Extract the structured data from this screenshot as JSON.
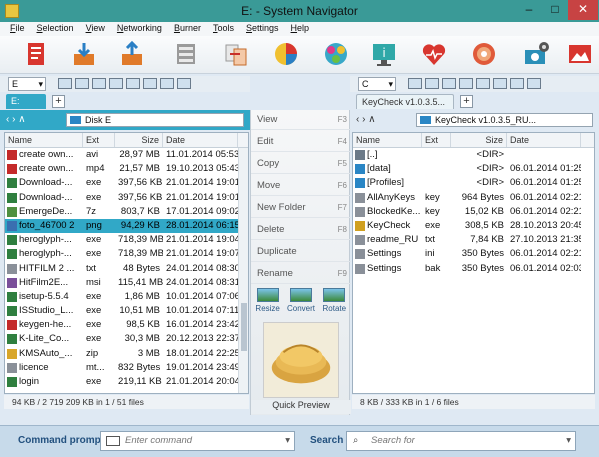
{
  "window": {
    "title": "E: - System Navigator",
    "min": "–",
    "max": "□",
    "close": "✕"
  },
  "menu": [
    "File",
    "Selection",
    "View",
    "Networking",
    "Burner",
    "Tools",
    "Settings",
    "Help"
  ],
  "toolbar_icons": [
    "red-document-icon",
    "download-box-icon",
    "upload-box-icon",
    "archive-icon",
    "compare-icon",
    "pie-chart-icon",
    "network-icon",
    "info-monitor-icon",
    "heart-pulse-icon",
    "disc-icon",
    "camera-gear-icon"
  ],
  "left": {
    "drive": "E",
    "tab": "E:",
    "path": "Disk E",
    "columns": [
      "Name",
      "Ext",
      "Size",
      "Date"
    ],
    "rows": [
      {
        "name": "create own...",
        "ext": "avi",
        "size": "28,97 MB",
        "date": "11.01.2014 05:53",
        "icon": "video-file-icon",
        "color": "#c42a2a"
      },
      {
        "name": "create own...",
        "ext": "mp4",
        "size": "21,57 MB",
        "date": "19.10.2013 05:43",
        "icon": "video-file-icon",
        "color": "#c42a2a"
      },
      {
        "name": "Download-...",
        "ext": "exe",
        "size": "397,56 KB",
        "date": "21.01.2014 19:01",
        "icon": "exe-file-icon",
        "color": "#2f7f3f"
      },
      {
        "name": "Download-...",
        "ext": "exe",
        "size": "397,56 KB",
        "date": "21.01.2014 19:01",
        "icon": "exe-file-icon",
        "color": "#2f7f3f"
      },
      {
        "name": "EmergeDe...",
        "ext": "7z",
        "size": "803,7 KB",
        "date": "17.01.2014 09:02",
        "icon": "archive-file-icon",
        "color": "#4f8f3f"
      },
      {
        "name": "foto_46700 2",
        "ext": "png",
        "size": "94,29 KB",
        "date": "28.01.2014 06:15",
        "icon": "image-file-icon",
        "color": "#3a6fb0",
        "selected": true
      },
      {
        "name": "heroglyph-...",
        "ext": "exe",
        "size": "718,39 MB",
        "date": "21.01.2014 19:04",
        "icon": "exe-file-icon",
        "color": "#2f7f3f"
      },
      {
        "name": "heroglyph-...",
        "ext": "exe",
        "size": "718,39 MB",
        "date": "21.01.2014 19:07",
        "icon": "exe-file-icon",
        "color": "#2f7f3f"
      },
      {
        "name": "HITFILM 2 ...",
        "ext": "txt",
        "size": "48 Bytes",
        "date": "24.01.2014 08:30",
        "icon": "text-file-icon",
        "color": "#8a9099"
      },
      {
        "name": "HitFilm2E...",
        "ext": "msi",
        "size": "115,41 MB",
        "date": "24.01.2014 08:31",
        "icon": "installer-file-icon",
        "color": "#7a4f9a"
      },
      {
        "name": "isetup-5.5.4",
        "ext": "exe",
        "size": "1,86 MB",
        "date": "10.01.2014 07:06",
        "icon": "exe-file-icon",
        "color": "#2f7f3f"
      },
      {
        "name": "ISStudio_L...",
        "ext": "exe",
        "size": "10,51 MB",
        "date": "10.01.2014 07:11",
        "icon": "exe-file-icon",
        "color": "#2f7f3f"
      },
      {
        "name": "keygen-he...",
        "ext": "exe",
        "size": "98,5 KB",
        "date": "16.01.2014 23:42",
        "icon": "exe-file-icon",
        "color": "#c42a2a"
      },
      {
        "name": "K-Lite_Co...",
        "ext": "exe",
        "size": "30,3 MB",
        "date": "20.12.2013 22:37",
        "icon": "exe-file-icon",
        "color": "#2f7f3f"
      },
      {
        "name": "KMSAuto_...",
        "ext": "zip",
        "size": "3 MB",
        "date": "18.01.2014 22:25",
        "icon": "zip-file-icon",
        "color": "#d8a62a"
      },
      {
        "name": "licence",
        "ext": "mt...",
        "size": "832 Bytes",
        "date": "19.01.2014 23:49",
        "icon": "text-file-icon",
        "color": "#8a9099"
      },
      {
        "name": "login",
        "ext": "exe",
        "size": "219,11 KB",
        "date": "21.01.2014 20:04",
        "icon": "exe-file-icon",
        "color": "#2f7f3f"
      }
    ],
    "status": "94 KB / 2 719 209 KB  in 1 / 51 files"
  },
  "right": {
    "drive": "C",
    "tab": "KeyCheck v1.0.3.5...",
    "path": "KeyCheck v1.0.3.5_RU...",
    "columns": [
      "Name",
      "Ext",
      "Size",
      "Date"
    ],
    "rows": [
      {
        "name": "[..]",
        "ext": "",
        "size": "<DIR>",
        "date": "",
        "icon": "up-folder-icon",
        "color": "#6c7a88"
      },
      {
        "name": "[data]",
        "ext": "",
        "size": "<DIR>",
        "date": "06.01.2014 01:25",
        "icon": "folder-icon",
        "color": "#2a86c5"
      },
      {
        "name": "[Profiles]",
        "ext": "",
        "size": "<DIR>",
        "date": "06.01.2014 01:25",
        "icon": "folder-icon",
        "color": "#2a86c5"
      },
      {
        "name": "AllAnyKeys",
        "ext": "key",
        "size": "964 Bytes",
        "date": "06.01.2014 02:21",
        "icon": "key-file-icon",
        "color": "#8a9099"
      },
      {
        "name": "BlockedKe...",
        "ext": "key",
        "size": "15,02 KB",
        "date": "06.01.2014 02:21",
        "icon": "key-file-icon",
        "color": "#8a9099"
      },
      {
        "name": "KeyCheck",
        "ext": "exe",
        "size": "308,5 KB",
        "date": "28.10.2013 20:45",
        "icon": "keycheck-app-icon",
        "color": "#d0a020"
      },
      {
        "name": "readme_RU",
        "ext": "txt",
        "size": "7,84 KB",
        "date": "27.10.2013 21:35",
        "icon": "text-file-icon",
        "color": "#8a9099"
      },
      {
        "name": "Settings",
        "ext": "ini",
        "size": "350 Bytes",
        "date": "06.01.2014 02:21",
        "icon": "settings-file-icon",
        "color": "#8a9099"
      },
      {
        "name": "Settings",
        "ext": "bak",
        "size": "350 Bytes",
        "date": "06.01.2014 02:03",
        "icon": "settings-file-icon",
        "color": "#8a9099"
      }
    ],
    "status": "8 KB / 333 KB  in 1 / 6 files"
  },
  "commands": [
    {
      "label": "View",
      "key": "F3"
    },
    {
      "label": "Edit",
      "key": "F4"
    },
    {
      "label": "Copy",
      "key": "F5"
    },
    {
      "label": "Move",
      "key": "F6"
    },
    {
      "label": "New Folder",
      "key": "F7"
    },
    {
      "label": "Delete",
      "key": "F8"
    },
    {
      "label": "Duplicate",
      "key": ""
    },
    {
      "label": "Rename",
      "key": "F9"
    }
  ],
  "image_tools": [
    "Resize",
    "Convert",
    "Rotate"
  ],
  "quick_preview": "Quick Preview",
  "bottom": {
    "command_label": "Command prompt",
    "command_placeholder": "Enter command",
    "search_label": "Search",
    "search_placeholder": "Search for"
  }
}
